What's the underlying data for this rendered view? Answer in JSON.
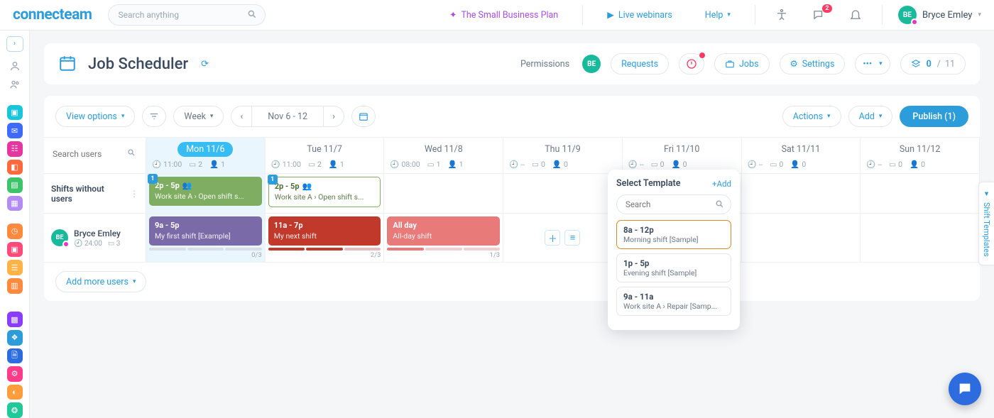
{
  "brand": "connecteam",
  "search_placeholder": "Search anything",
  "top": {
    "plan": "The Small Business Plan",
    "webinars": "Live webinars",
    "help": "Help",
    "chat_badge": "2",
    "user_initials": "BE",
    "user_name": "Bryce Emley"
  },
  "page": {
    "title": "Job Scheduler",
    "permissions_label": "Permissions",
    "perm_initials": "BE",
    "requests": "Requests",
    "jobs": "Jobs",
    "settings": "Settings",
    "count_current": "0",
    "count_total": "11"
  },
  "toolbar": {
    "view_options": "View options",
    "granularity": "Week",
    "date_range": "Nov 6 - 12",
    "actions": "Actions",
    "add": "Add",
    "publish": "Publish (1)",
    "add_more_users": "Add more users"
  },
  "days": [
    {
      "label": "Mon 11/6",
      "today": true,
      "time": "11:00",
      "jobs": "2",
      "users": "1"
    },
    {
      "label": "Tue 11/7",
      "today": false,
      "time": "11:00",
      "jobs": "2",
      "users": "1"
    },
    {
      "label": "Wed 11/8",
      "today": false,
      "time": "08:00",
      "jobs": "1",
      "users": "1"
    },
    {
      "label": "Thu 11/9",
      "today": false,
      "time": "--",
      "jobs": "0",
      "users": "0"
    },
    {
      "label": "Fri 11/10",
      "today": false,
      "time": "--",
      "jobs": "0",
      "users": "0"
    },
    {
      "label": "Sat 11/11",
      "today": false,
      "time": "--",
      "jobs": "0",
      "users": "0"
    },
    {
      "label": "Sun 11/12",
      "today": false,
      "time": "--",
      "jobs": "0",
      "users": "0"
    }
  ],
  "rows": {
    "unassigned_label": "Shifts without users",
    "search_users_placeholder": "Search users",
    "user": {
      "initials": "BE",
      "name": "Bryce Emley",
      "hours": "24:00",
      "shifts": "3"
    }
  },
  "shifts": {
    "mon_open": {
      "badge": "1",
      "time": "2p - 5p",
      "sub": "Work site A › Open shift s..."
    },
    "tue_open": {
      "badge": "1",
      "time": "2p - 5p",
      "sub": "Work site A › Open shift s..."
    },
    "mon_user": {
      "time": "9a - 5p",
      "sub": "My first shift [Example]",
      "ratio": "0/3"
    },
    "tue_user": {
      "time": "11a - 7p",
      "sub": "My next shift",
      "ratio": "2/3"
    },
    "wed_user": {
      "time": "All day",
      "sub": "All-day shift",
      "ratio": "1/3"
    }
  },
  "popover": {
    "title": "Select Template",
    "add": "+Add",
    "search_placeholder": "Search",
    "templates": [
      {
        "time": "8a - 12p",
        "name": "Morning shift [Sample]"
      },
      {
        "time": "1p - 5p",
        "name": "Evening shift [Sample]"
      },
      {
        "time": "9a - 11a",
        "name": "Work site A › Repair [Samp..."
      }
    ]
  },
  "side_tab": "Shift Templates"
}
